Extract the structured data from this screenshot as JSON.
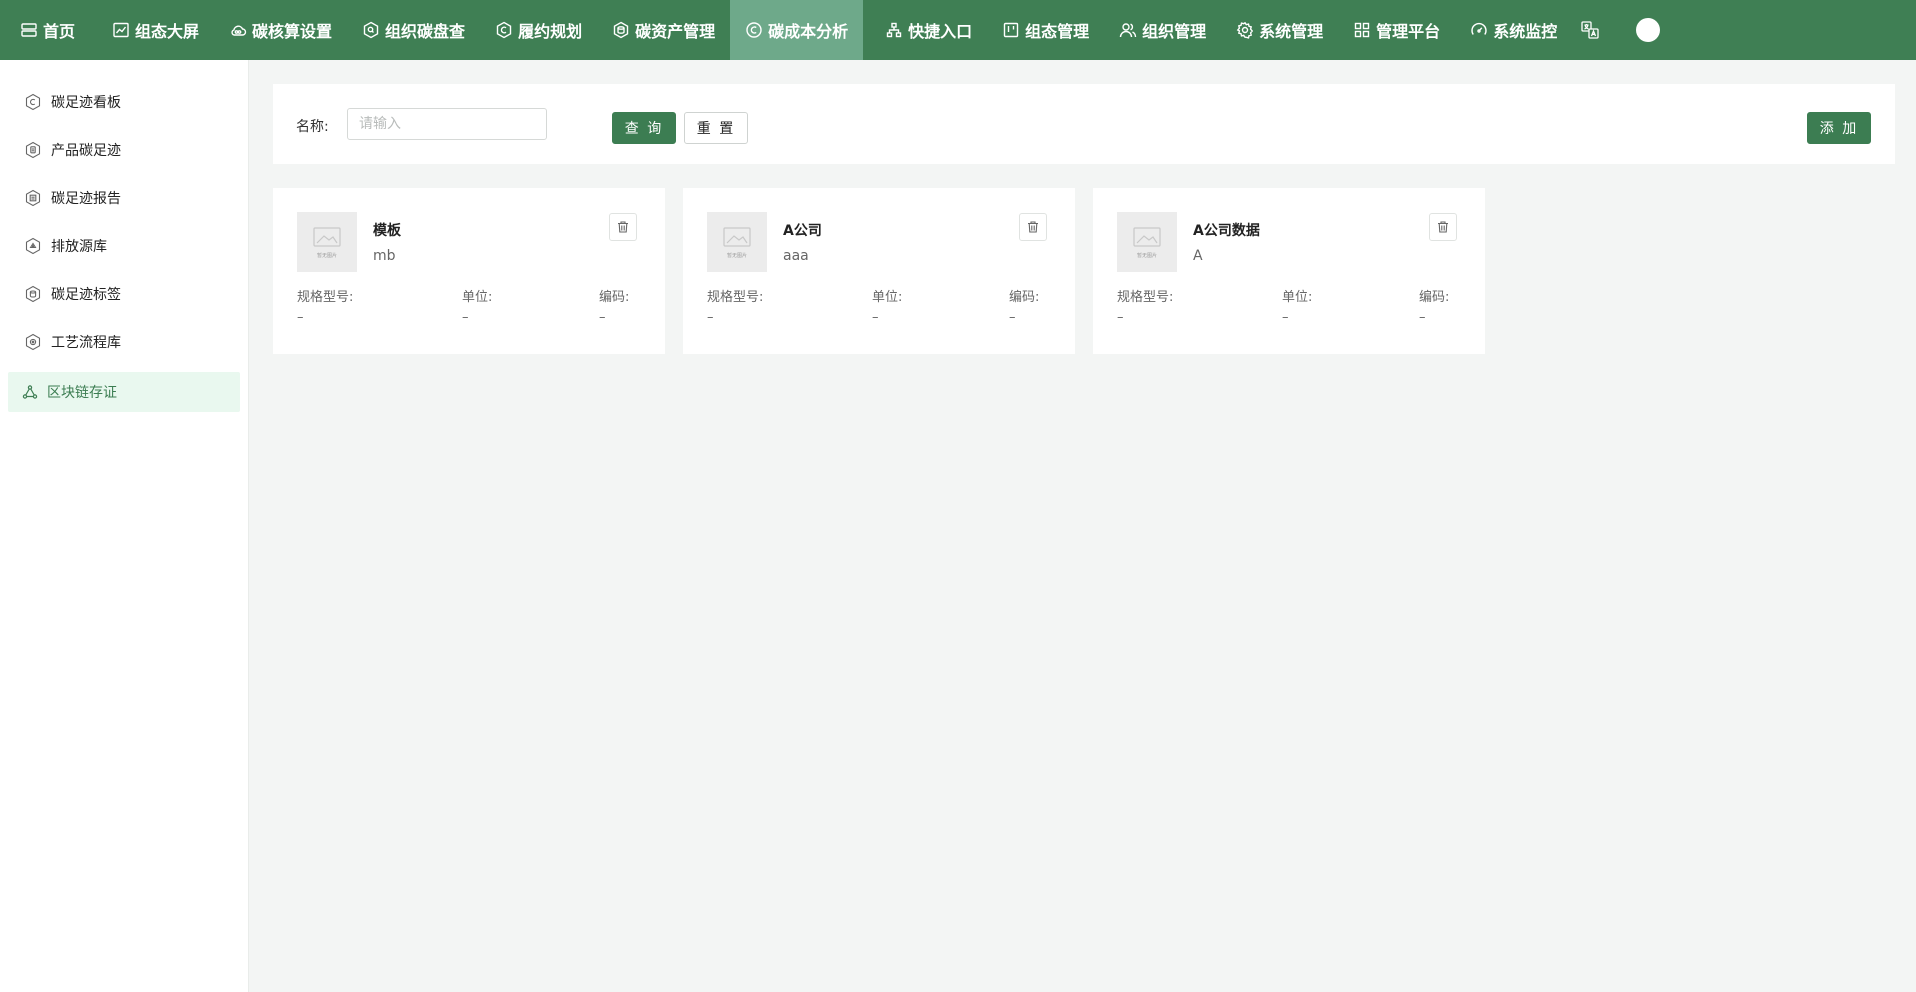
{
  "topnav": {
    "items": [
      {
        "label": "首页",
        "icon": "server-icon"
      },
      {
        "label": "组态大屏",
        "icon": "chart-line-icon"
      },
      {
        "label": "碳核算设置",
        "icon": "cloud-co2-icon"
      },
      {
        "label": "组织碳盘查",
        "icon": "hex-search-icon"
      },
      {
        "label": "履约规划",
        "icon": "hex-c-icon"
      },
      {
        "label": "碳资产管理",
        "icon": "hex-db-icon"
      },
      {
        "label": "碳成本分析",
        "icon": "circle-c-icon",
        "active": true
      },
      {
        "label": "快捷入口",
        "icon": "sitemap-icon"
      },
      {
        "label": "组态管理",
        "icon": "kanban-icon"
      },
      {
        "label": "组织管理",
        "icon": "users-icon"
      },
      {
        "label": "系统管理",
        "icon": "gear-icon"
      },
      {
        "label": "管理平台",
        "icon": "grid-icon"
      },
      {
        "label": "系统监控",
        "icon": "gauge-icon"
      }
    ],
    "accent_color": "#3f7f54",
    "active_color": "#6ea98a"
  },
  "sidebar": {
    "items": [
      {
        "label": "碳足迹看板",
        "icon": "hex-c-icon"
      },
      {
        "label": "产品碳足迹",
        "icon": "hex-doc-icon"
      },
      {
        "label": "碳足迹报告",
        "icon": "hex-report-icon"
      },
      {
        "label": "排放源库",
        "icon": "hex-recycle-icon"
      },
      {
        "label": "碳足迹标签",
        "icon": "hex-tag-icon"
      },
      {
        "label": "工艺流程库",
        "icon": "hex-flow-icon"
      },
      {
        "label": "区块链存证",
        "icon": "blockchain-icon",
        "active": true
      }
    ]
  },
  "search": {
    "label": "名称:",
    "placeholder": "请输入",
    "value": "",
    "query_label": "查 询",
    "reset_label": "重 置",
    "add_label": "添 加"
  },
  "cards": [
    {
      "title": "模板",
      "subtitle": "mb",
      "thumb_caption": "暂无图片",
      "fields": [
        {
          "label": "规格型号:",
          "value": "–"
        },
        {
          "label": "单位:",
          "value": "–"
        },
        {
          "label": "编码:",
          "value": "–"
        }
      ]
    },
    {
      "title": "A公司",
      "subtitle": "aaa",
      "thumb_caption": "暂无图片",
      "fields": [
        {
          "label": "规格型号:",
          "value": "–"
        },
        {
          "label": "单位:",
          "value": "–"
        },
        {
          "label": "编码:",
          "value": "–"
        }
      ]
    },
    {
      "title": "A公司数据",
      "subtitle": "A",
      "thumb_caption": "暂无图片",
      "fields": [
        {
          "label": "规格型号:",
          "value": "–"
        },
        {
          "label": "单位:",
          "value": "–"
        },
        {
          "label": "编码:",
          "value": "–"
        }
      ]
    }
  ]
}
